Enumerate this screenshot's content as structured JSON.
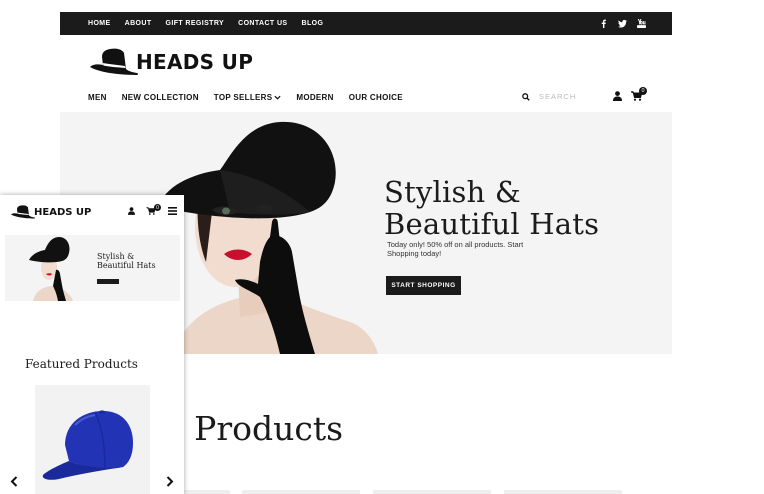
{
  "desktop": {
    "top_nav": [
      "HOME",
      "ABOUT",
      "GIFT REGISTRY",
      "CONTACT US",
      "BLOG"
    ],
    "social_icons": [
      "facebook-icon",
      "twitter-icon",
      "youtube-icon"
    ],
    "brand": "HEADS UP",
    "main_nav": [
      "MEN",
      "NEW COLLECTION",
      "TOP SELLERS",
      "MODERN",
      "OUR CHOICE"
    ],
    "search_placeholder": "SEARCH",
    "cart_count": "0",
    "hero": {
      "title_line1": "Stylish &",
      "title_line2": "Beautiful Hats",
      "subtitle": "Today only! 50% off on  all products. Start Shopping today!",
      "button": "START SHOPPING"
    },
    "featured_title": "ured Products"
  },
  "mobile": {
    "brand": "HEADS UP",
    "cart_count": "0",
    "hero": {
      "title_line1": "Stylish &",
      "title_line2": "Beautiful Hats"
    },
    "featured_title": "Featured Products"
  },
  "colors": {
    "dark": "#1b1b1b",
    "hero_bg": "#f4f4f4",
    "accent_red": "#c8102e",
    "cap_blue": "#2233b5"
  }
}
